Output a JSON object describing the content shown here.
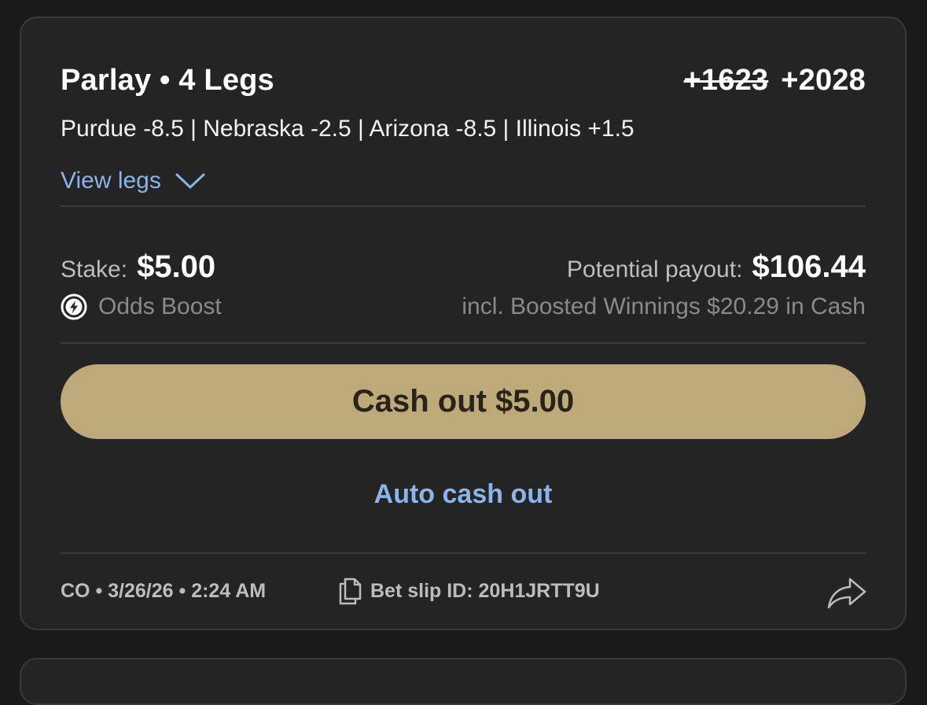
{
  "bet": {
    "title": "Parlay • 4 Legs",
    "old_odds": "+1623",
    "new_odds": "+2028",
    "legs_summary": "Purdue -8.5 | Nebraska -2.5 | Arizona -8.5 | Illinois +1.5",
    "view_legs_label": "View legs",
    "stake_label": "Stake:",
    "stake_value": "$5.00",
    "payout_label": "Potential payout:",
    "payout_value": "$106.44",
    "boost_label": "Odds Boost",
    "boost_note": "incl. Boosted Winnings $20.29 in Cash",
    "cashout_label": "Cash out $5.00",
    "auto_cashout_label": "Auto cash out",
    "meta": "CO • 3/26/26 • 2:24 AM",
    "slip_id": "Bet slip ID: 20H1JRTT9U"
  },
  "colors": {
    "background": "#1a1a1a",
    "card": "#242424",
    "accent_link": "#8ab4ea",
    "cashout_button": "#bda97a"
  },
  "icons": {
    "view_legs": "chevron-down-icon",
    "boost": "lightning-bolt-icon",
    "slip": "document-copy-icon",
    "share": "share-arrow-icon"
  }
}
